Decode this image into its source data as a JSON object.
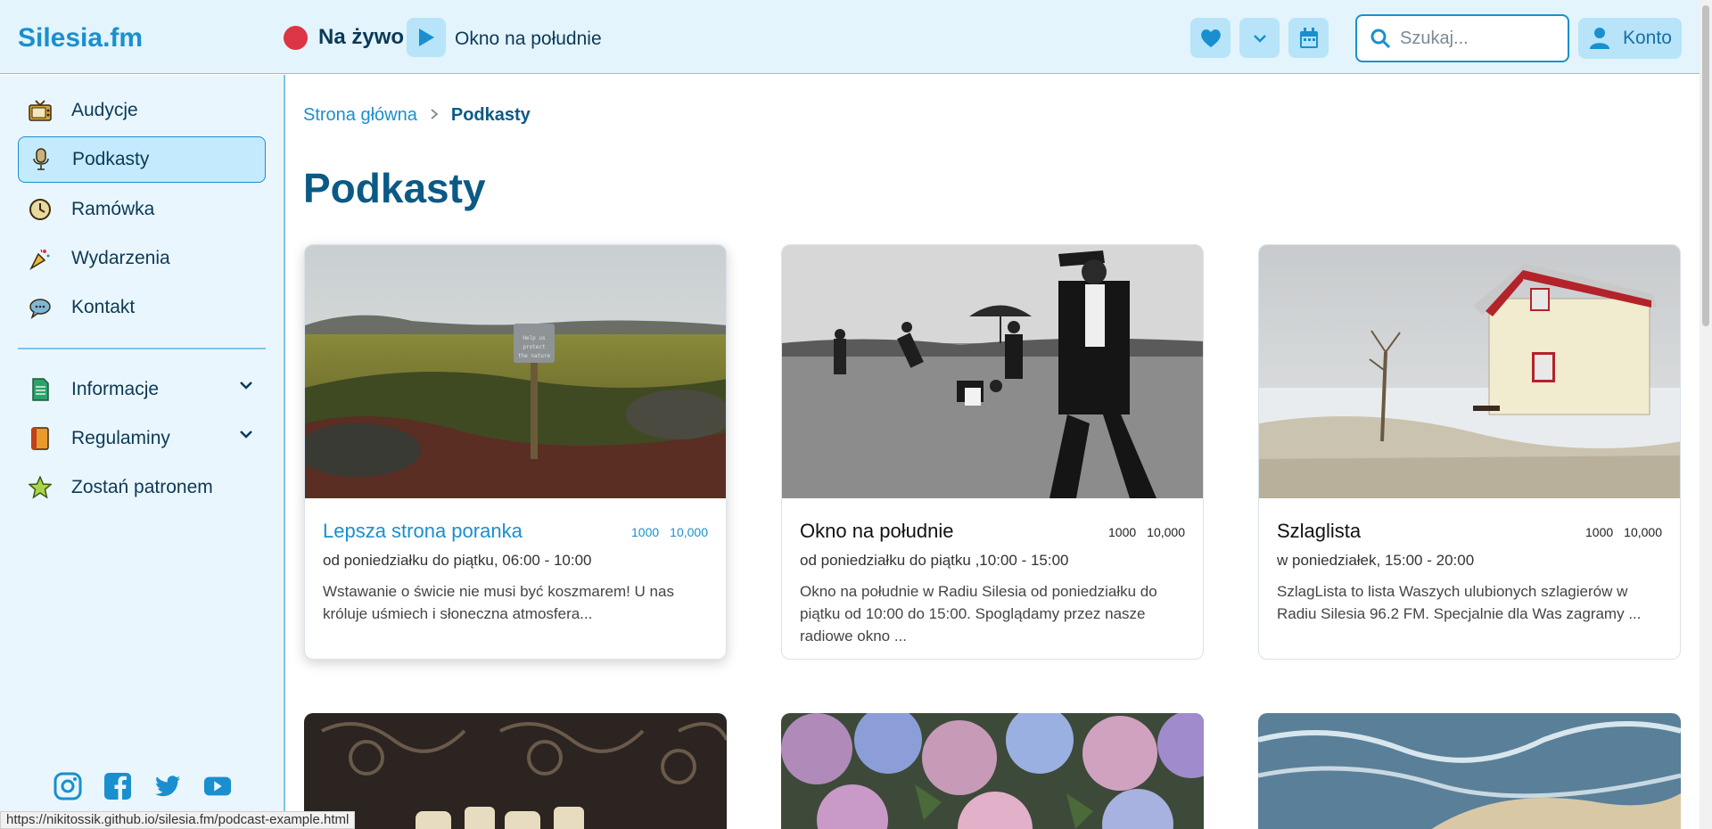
{
  "header": {
    "brand": "Silesia.fm",
    "live_label": "Na żywo",
    "now_playing": "Okno na południe",
    "search_placeholder": "Szukaj...",
    "account_label": "Konto",
    "buttons": [
      "heart-icon",
      "chevron-down-icon",
      "calendar-icon"
    ]
  },
  "sidebar": {
    "items": [
      {
        "label": "Audycje",
        "icon": "tv-icon"
      },
      {
        "label": "Podkasty",
        "icon": "microphone-icon",
        "active": true
      },
      {
        "label": "Ramówka",
        "icon": "clock-icon"
      },
      {
        "label": "Wydarzenia",
        "icon": "party-icon"
      },
      {
        "label": "Kontakt",
        "icon": "speech-bubble-icon"
      },
      {
        "label": "Informacje",
        "icon": "document-icon",
        "expandable": true
      },
      {
        "label": "Regulaminy",
        "icon": "book-icon",
        "expandable": true
      },
      {
        "label": "Zostań patronem",
        "icon": "star-icon"
      }
    ],
    "socials": [
      "instagram-icon",
      "facebook-icon",
      "twitter-icon",
      "youtube-icon"
    ]
  },
  "breadcrumb": {
    "home": "Strona główna",
    "current": "Podkasty"
  },
  "page_title": "Podkasty",
  "cards": [
    {
      "title": "Lepsza strona poranka",
      "stat1": "1000",
      "stat2": "10,000",
      "schedule": "od poniedziałku do piątku, 06:00 - 10:00",
      "description": "Wstawanie o świcie nie musi być koszmarem! U nas króluje uśmiech i słoneczna atmosfera...",
      "image_sign": "Help us protect the nature"
    },
    {
      "title": "Okno na południe",
      "stat1": "1000",
      "stat2": "10,000",
      "schedule": "od poniedziałku do piątku ,10:00 - 15:00",
      "description": "Okno na południe w Radiu Silesia od poniedziałku do piątku od 10:00 do 15:00. Spoglądamy przez nasze radiowe okno ..."
    },
    {
      "title": "Szlaglista",
      "stat1": "1000",
      "stat2": "10,000",
      "schedule": "w poniedziałek, 15:00 - 20:00",
      "description": "SzlagLista to lista Waszych ulubionych szlagierów w Radiu Silesia 96.2 FM. Specjalnie dla Was zagramy ..."
    }
  ],
  "status_url": "https://nikitossik.github.io/silesia.fm/podcast-example.html",
  "colors": {
    "accent": "#1a8fcf",
    "dark": "#0b5a86",
    "header_bg": "#e3f4fc",
    "live_dot": "#dc3545"
  }
}
